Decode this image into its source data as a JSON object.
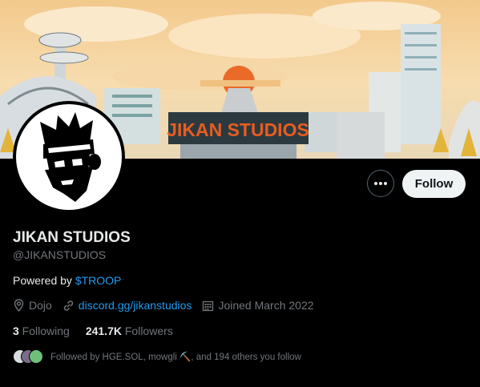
{
  "profile": {
    "name": "JIKAN STUDIOS",
    "handle": "@JIKANSTUDIOS",
    "bio_prefix": "Powered by ",
    "bio_link": "$TROOP",
    "banner_text": "JIKAN STUDIOS"
  },
  "actions": {
    "more_label": "More",
    "follow_label": "Follow"
  },
  "meta": {
    "location": "Dojo",
    "website": "discord.gg/jikanstudios",
    "joined": "Joined March 2022"
  },
  "stats": {
    "following_count": "3",
    "following_label": " Following",
    "followers_count": "241.7K",
    "followers_label": " Followers"
  },
  "followed_by": {
    "text": "Followed by HGE.SOL, mowgli ⛏️, and 194 others you follow"
  },
  "colors": {
    "background": "#000000",
    "link": "#1d9bf0",
    "secondary_text": "#71767b",
    "follow_button": "#eff3f4"
  }
}
